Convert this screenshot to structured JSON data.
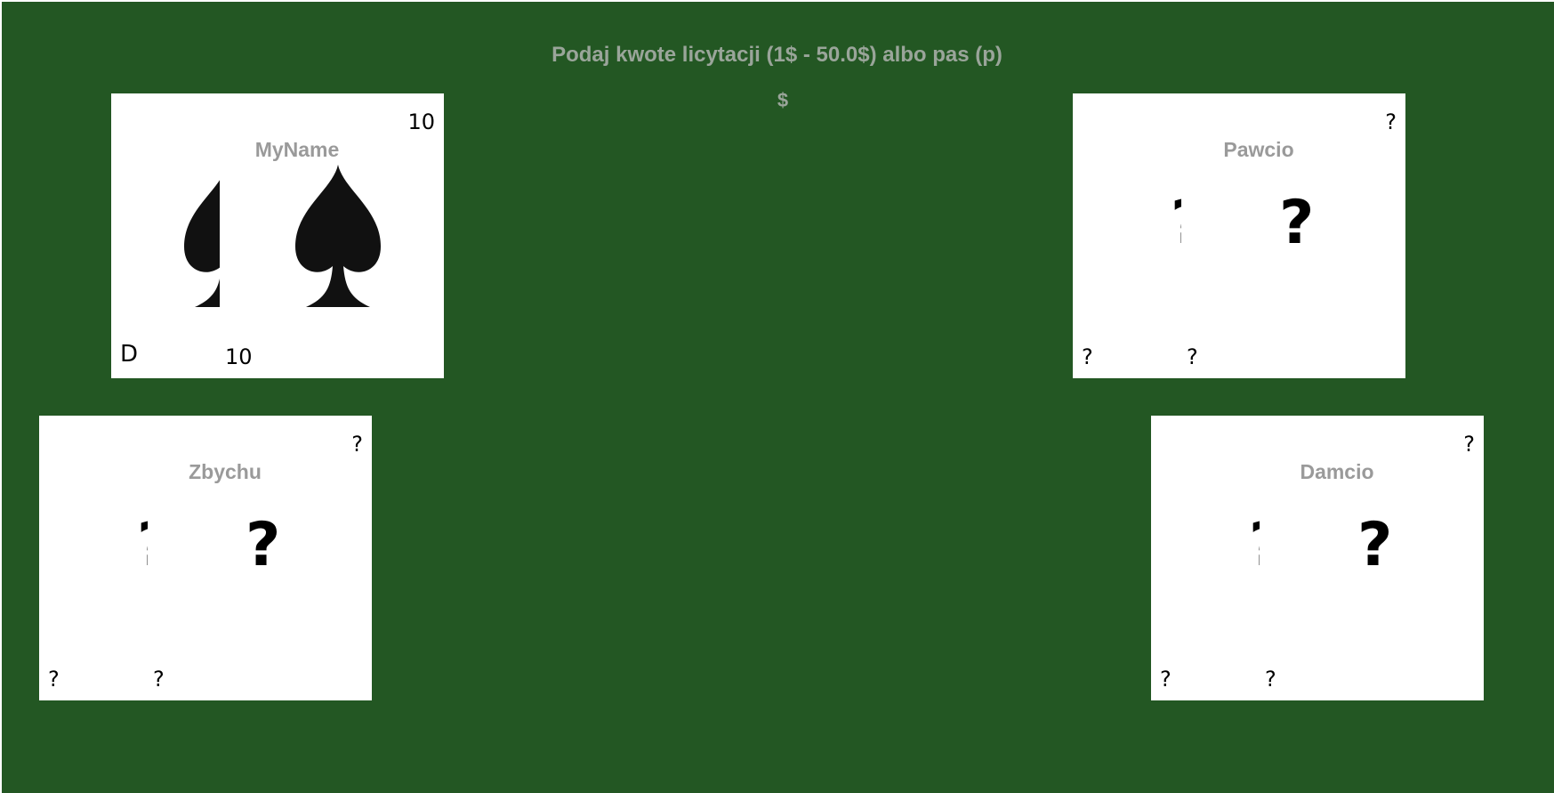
{
  "prompt": {
    "text": "Podaj kwote licytacji (1$ - 50.0$) albo pas (p)",
    "currency": "$"
  },
  "players": {
    "me": {
      "name": "MyName",
      "top_right": "10",
      "bottom_center": "10",
      "dealer": "D",
      "cards": [
        "spade-icon",
        "spade-icon"
      ]
    },
    "pawcio": {
      "name": "Pawcio",
      "top_right": "?",
      "bottom_left": "?",
      "bottom_center": "?",
      "card_left": "?",
      "card_right": "?"
    },
    "zbychu": {
      "name": "Zbychu",
      "top_right": "?",
      "bottom_left": "?",
      "bottom_center": "?",
      "card_left": "?",
      "card_right": "?"
    },
    "damcio": {
      "name": "Damcio",
      "top_right": "?",
      "bottom_left": "?",
      "bottom_center": "?",
      "card_left": "?",
      "card_right": "?"
    }
  },
  "colors": {
    "table": "#235723",
    "text_muted": "#9aa59a",
    "panel": "#ffffff"
  }
}
